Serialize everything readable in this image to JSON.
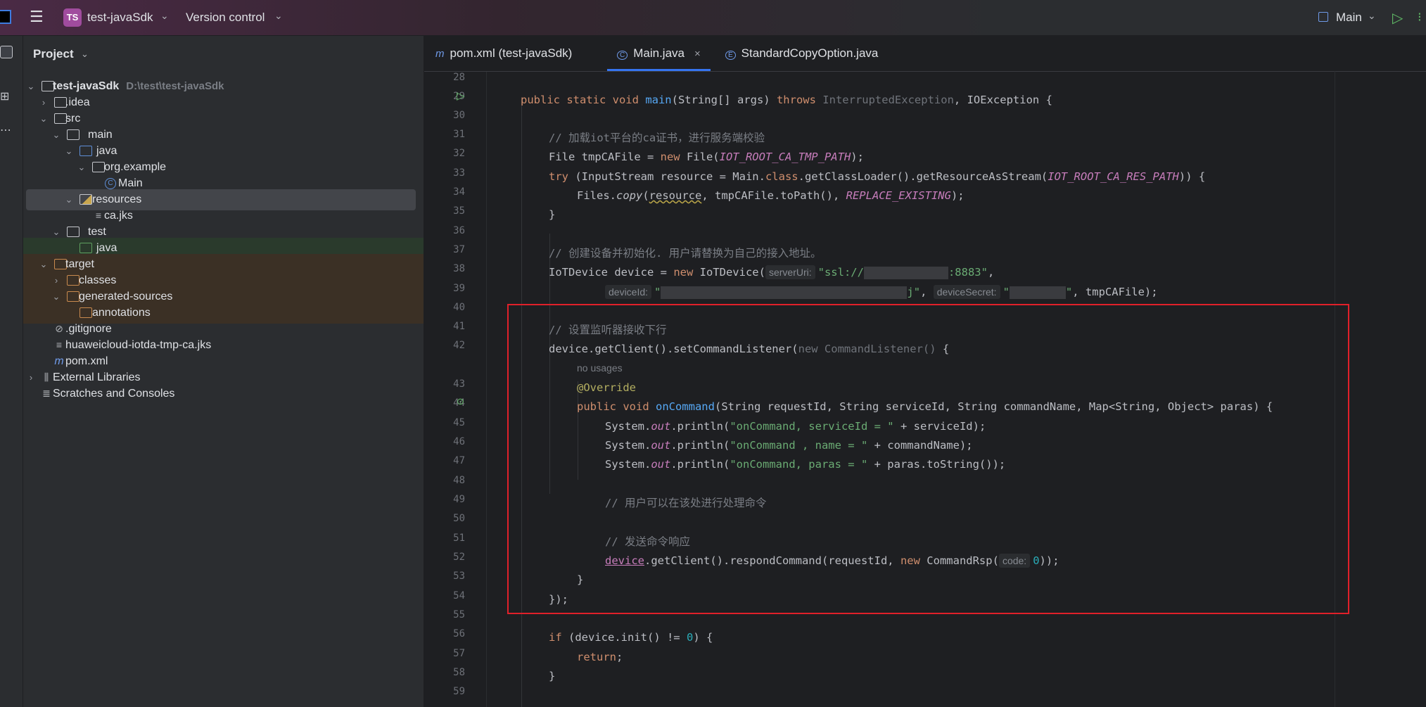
{
  "titlebar": {
    "project_badge": "TS",
    "project_name": "test-javaSdk",
    "vcs_label": "Version control",
    "run_config": "Main"
  },
  "project_panel": {
    "title": "Project",
    "tree": [
      {
        "label": "test-javaSdk",
        "hint": "D:\\test\\test-javaSdk"
      },
      {
        "label": ".idea"
      },
      {
        "label": "src"
      },
      {
        "label": "main"
      },
      {
        "label": "java"
      },
      {
        "label": "org.example"
      },
      {
        "label": "Main"
      },
      {
        "label": "resources"
      },
      {
        "label": "ca.jks"
      },
      {
        "label": "test"
      },
      {
        "label": "java"
      },
      {
        "label": "target"
      },
      {
        "label": "classes"
      },
      {
        "label": "generated-sources"
      },
      {
        "label": "annotations"
      },
      {
        "label": ".gitignore"
      },
      {
        "label": "huaweicloud-iotda-tmp-ca.jks"
      },
      {
        "label": "pom.xml"
      },
      {
        "label": "External Libraries"
      },
      {
        "label": "Scratches and Consoles"
      }
    ]
  },
  "tabs": [
    {
      "label": "pom.xml (test-javaSdk)",
      "icon": "m"
    },
    {
      "label": "Main.java",
      "icon": "C",
      "active": true
    },
    {
      "label": "StandardCopyOption.java",
      "icon": "E"
    }
  ],
  "line_numbers": [
    "28",
    "29",
    "30",
    "31",
    "32",
    "33",
    "34",
    "35",
    "36",
    "37",
    "38",
    "39",
    "40",
    "41",
    "42",
    "43",
    "44",
    "45",
    "46",
    "47",
    "48",
    "49",
    "50",
    "51",
    "52",
    "53",
    "54",
    "55",
    "56",
    "57",
    "58",
    "59"
  ],
  "code": {
    "l29_public_static_void": "public static void ",
    "l29_main": "main",
    "l29_args": "(String[] args) ",
    "l29_throws": "throws ",
    "l29_ex1": "InterruptedException",
    "l29_ex2": ", IOException {",
    "l31": "// 加载iot平台的ca证书，进行服务端校验",
    "l32_a": "File tmpCAFile = ",
    "l32_new": "new ",
    "l32_b": "File(",
    "l32_const": "IOT_ROOT_CA_TMP_PATH",
    "l32_c": ");",
    "l33_try": "try ",
    "l33_a": "(InputStream resource = Main.",
    "l33_class": "class",
    "l33_b": ".getClassLoader().getResourceAsStream(",
    "l33_const": "IOT_ROOT_CA_RES_PATH",
    "l33_c": ")) {",
    "l34_a": "Files.",
    "l34_copy": "copy",
    "l34_b": "(",
    "l34_res": "resource",
    "l34_c": ", tmpCAFile.toPath(), ",
    "l34_const": "REPLACE_EXISTING",
    "l34_d": ");",
    "l35": "}",
    "l37": "// 创建设备并初始化. 用户请替换为自己的接入地址。",
    "l38_a": "IoTDevice device = ",
    "l38_new": "new ",
    "l38_b": "IoTDevice(",
    "l38_hint": "serverUri:",
    "l38_str1": "\"ssl://",
    "l38_str2": ":8883\"",
    "l38_c": ",",
    "l39_hint1": "deviceId:",
    "l39_str1": "\"",
    "l39_str2": "j\"",
    "l39_comma": ", ",
    "l39_hint2": "deviceSecret:",
    "l39_str3": "\"",
    "l39_str4": "\"",
    "l39_tail": ", tmpCAFile);",
    "l41": "// 设置监听器接收下行",
    "l42_a": "device.getClient().setCommandListener(",
    "l42_dim": "new CommandListener() ",
    "l42_b": "{",
    "no_usages": "no usages",
    "l43": "@Override",
    "l44_kw": "public void ",
    "l44_fn": "onCommand",
    "l44_b": "(String requestId, String serviceId, String commandName, Map<String, Object> paras) {",
    "sys": "System.",
    "out": "out",
    "l45_a": ".println(",
    "l45_str": "\"onCommand, serviceId = \"",
    "l45_b": " + serviceId);",
    "l46_str": "\"onCommand , name = \"",
    "l46_b": " + commandName);",
    "l47_str": "\"onCommand, paras = \"",
    "l47_b": " + paras.toString());",
    "l49": "// 用户可以在该处进行处理命令",
    "l51": "// 发送命令响应",
    "l52_dev": "device",
    "l52_a": ".getClient().respondCommand(requestId, ",
    "l52_new": "new ",
    "l52_b": "CommandRsp(",
    "l52_hint": "code:",
    "l52_num": "0",
    "l52_c": "));",
    "l53": "}",
    "l54": "});",
    "l56_if": "if ",
    "l56_a": "(device.init() != ",
    "l56_num": "0",
    "l56_b": ") {",
    "l57_ret": "return",
    "l57_b": ";",
    "l58": "}"
  },
  "colors": {
    "highlight_box": "#e0202a",
    "accent": "#3574f0"
  }
}
